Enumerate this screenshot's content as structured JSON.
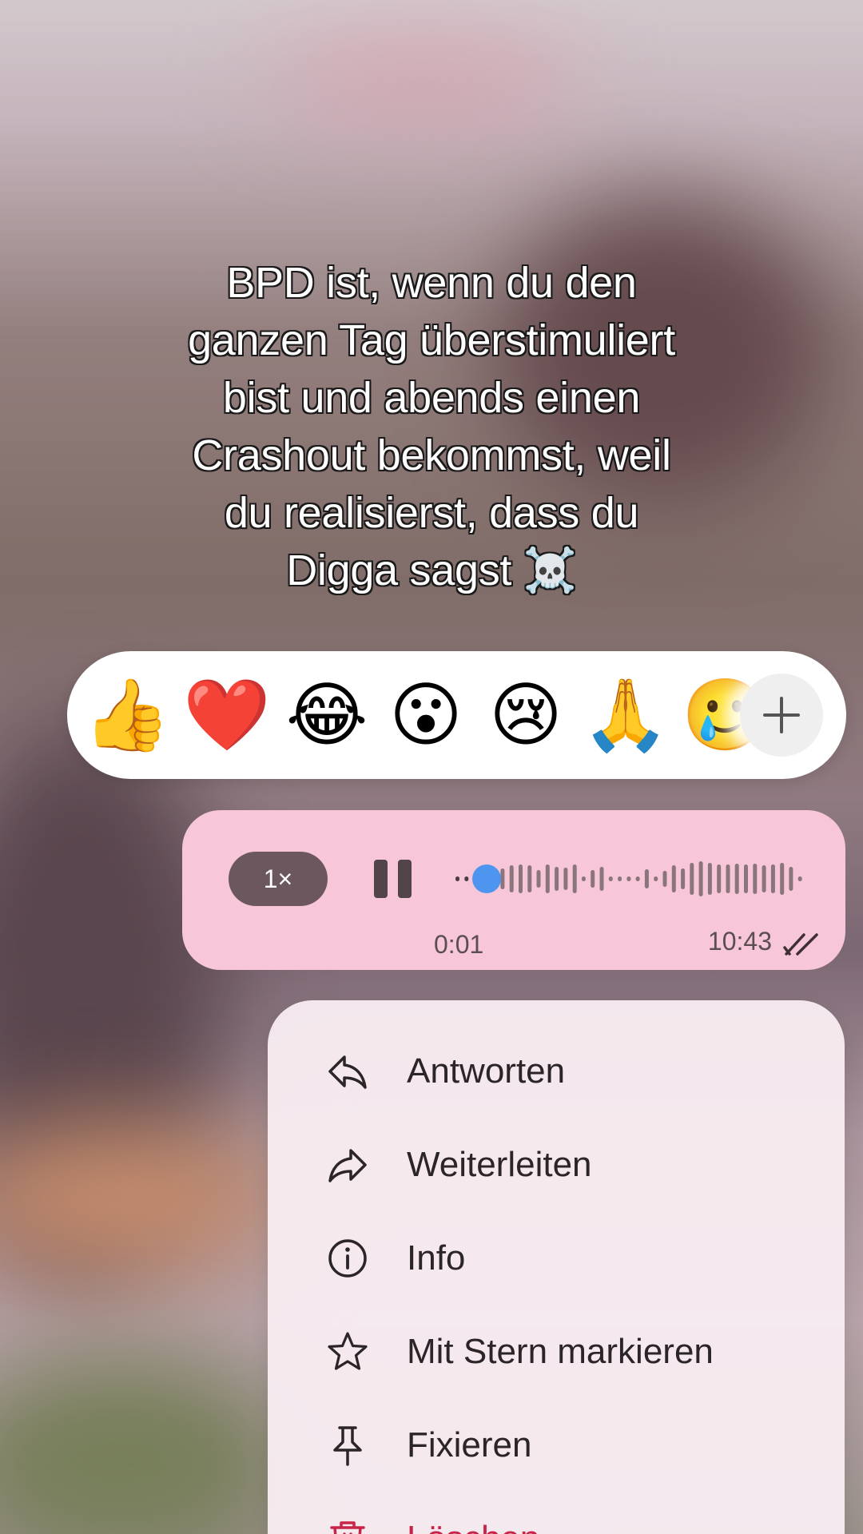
{
  "caption": {
    "lines": [
      "BPD ist, wenn du den",
      "ganzen Tag überstimuliert",
      "bist und abends einen",
      "Crashout bekommst, weil",
      "du realisierst, dass du",
      "Digga sagst ☠️"
    ]
  },
  "reactions": {
    "emojis": [
      "👍",
      "❤️",
      "😂",
      "😮",
      "😢",
      "🙏",
      "🥲"
    ],
    "add_icon": "plus-icon"
  },
  "voice_message": {
    "speed": "1×",
    "elapsed": "0:01",
    "time": "10:43",
    "progress": 0.05,
    "status_icon": "double-check-icon",
    "bubble_color": "#f7c6d8"
  },
  "menu": {
    "items": [
      {
        "label": "Antworten",
        "icon": "reply-icon"
      },
      {
        "label": "Weiterleiten",
        "icon": "forward-icon"
      },
      {
        "label": "Info",
        "icon": "info-icon"
      },
      {
        "label": "Mit Stern markieren",
        "icon": "star-icon"
      },
      {
        "label": "Fixieren",
        "icon": "pin-icon"
      },
      {
        "label": "Löschen",
        "icon": "trash-icon"
      }
    ],
    "danger_color": "#c8244a"
  }
}
